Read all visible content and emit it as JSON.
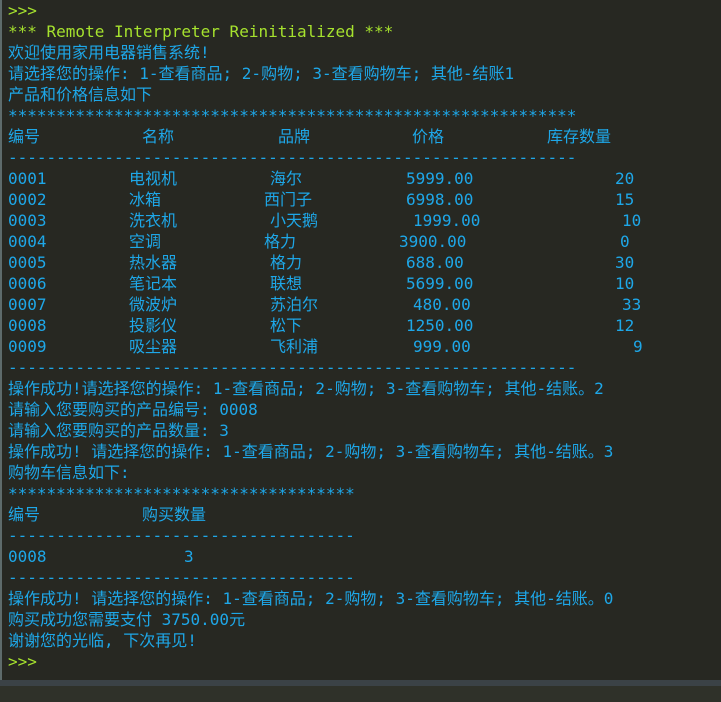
{
  "console": {
    "prompt": ">>>",
    "reinit": "*** Remote Interpreter Reinitialized ***",
    "welcome": "欢迎使用家用电器销售系统!",
    "menu1": "请选择您的操作: 1-查看商品; 2-购物; 3-查看购物车; 其他-结账1",
    "product_intro": "产品和价格信息如下",
    "stars_long": "***********************************************************",
    "dash_long": "-----------------------------------------------------------",
    "headers": [
      "编号",
      "名称",
      "品牌",
      "价格",
      "库存数量"
    ],
    "products": [
      {
        "id": "0001",
        "name": "电视机",
        "brand": "海尔",
        "price": "5999.00",
        "stock": "20"
      },
      {
        "id": "0002",
        "name": "冰箱",
        "brand": "西门子",
        "price": "6998.00",
        "stock": "15"
      },
      {
        "id": "0003",
        "name": "洗衣机",
        "brand": "小天鹅",
        "price": "1999.00",
        "stock": "10"
      },
      {
        "id": "0004",
        "name": "空调",
        "brand": "格力",
        "price": "3900.00",
        "stock": "0"
      },
      {
        "id": "0005",
        "name": "热水器",
        "brand": "格力",
        "price": "688.00",
        "stock": "30"
      },
      {
        "id": "0006",
        "name": "笔记本",
        "brand": "联想",
        "price": "5699.00",
        "stock": "10"
      },
      {
        "id": "0007",
        "name": "微波炉",
        "brand": "苏泊尔",
        "price": "480.00",
        "stock": "33"
      },
      {
        "id": "0008",
        "name": "投影仪",
        "brand": "松下",
        "price": "1250.00",
        "stock": "12"
      },
      {
        "id": "0009",
        "name": "吸尘器",
        "brand": "飞利浦",
        "price": "999.00",
        "stock": "9"
      }
    ],
    "success2": "操作成功!请选择您的操作: 1-查看商品; 2-购物; 3-查看购物车; 其他-结账。2",
    "ask_id": "请输入您要购买的产品编号: 0008",
    "ask_qty": "请输入您要购买的产品数量: 3",
    "success3": "操作成功! 请选择您的操作: 1-查看商品; 2-购物; 3-查看购物车; 其他-结账。3",
    "cart_intro": "购物车信息如下:",
    "stars_short": "************************************",
    "cart_headers": [
      "编号",
      "购买数量"
    ],
    "dash_short": "------------------------------------",
    "cart_rows": [
      {
        "id": "0008",
        "qty": "3"
      }
    ],
    "success0": "操作成功! 请选择您的操作: 1-查看商品; 2-购物; 3-查看购物车; 其他-结账。0",
    "pay": "购买成功您需要支付 3750.00元",
    "bye": "谢谢您的光临, 下次再见!",
    "prompt_end": ">>>"
  }
}
